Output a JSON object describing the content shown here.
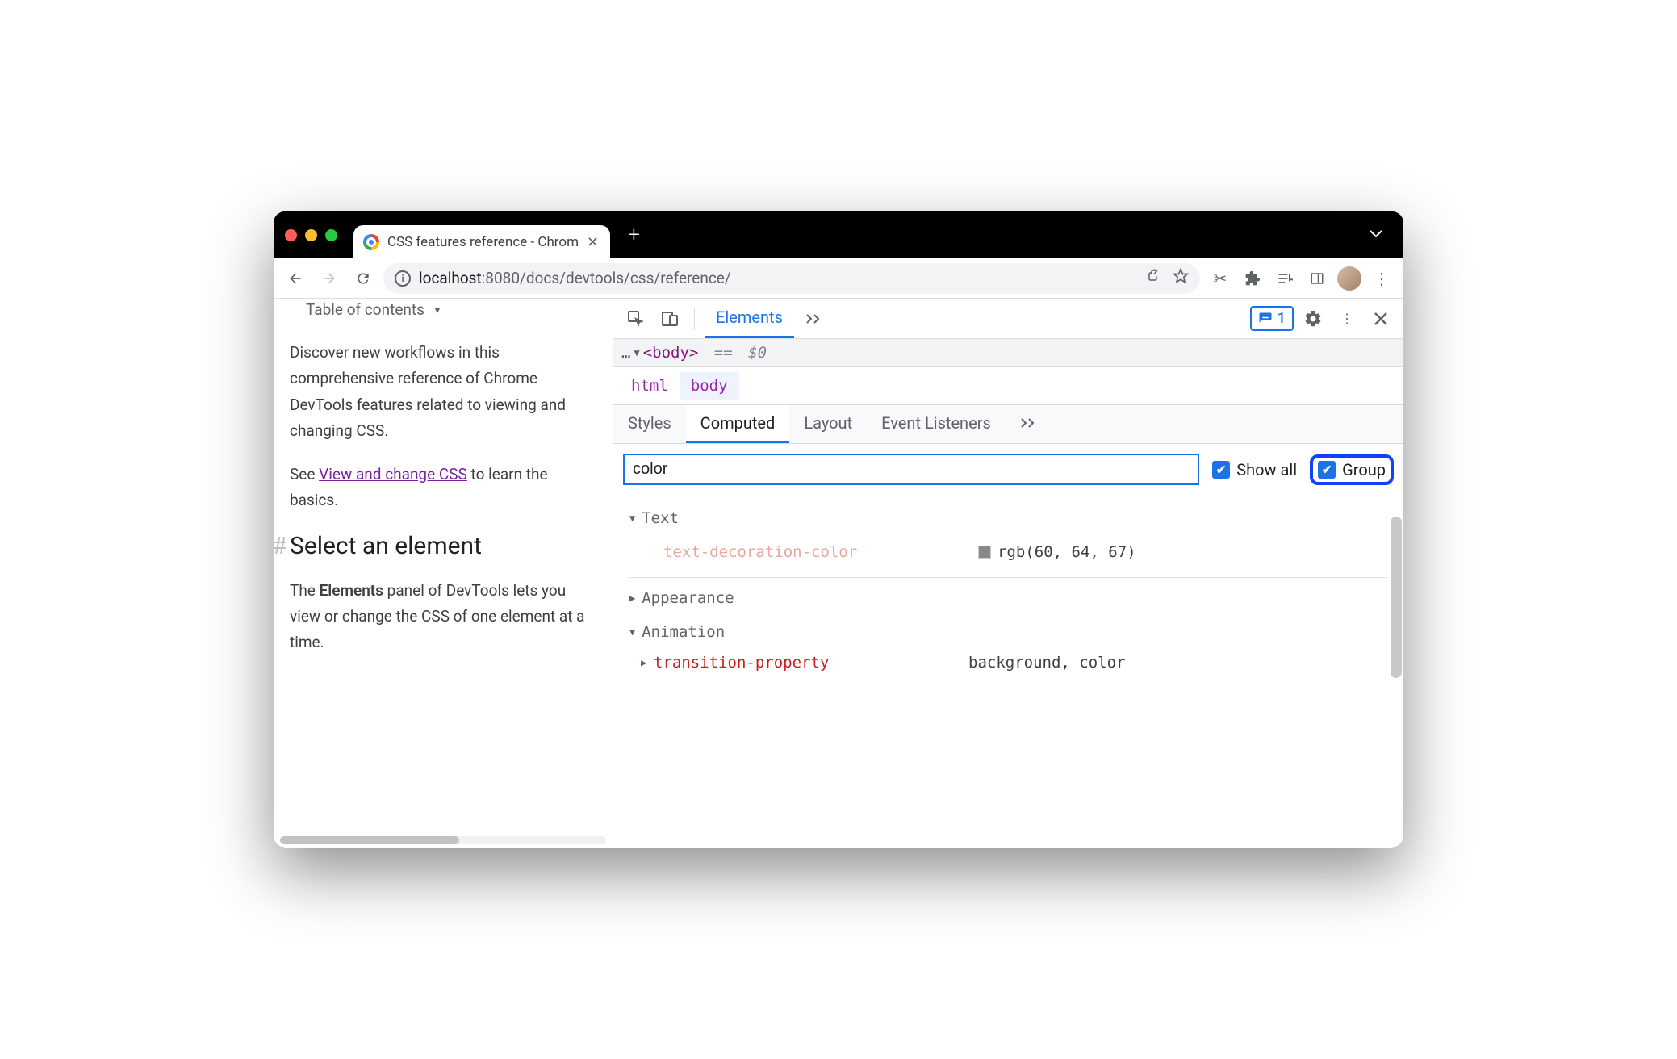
{
  "tab": {
    "title": "CSS features reference - Chrom"
  },
  "url": {
    "host": "localhost",
    "port": ":8080",
    "path": "/docs/devtools/css/reference/"
  },
  "page": {
    "toc_label": "Table of contents",
    "intro": "Discover new workflows in this comprehensive reference of Chrome DevTools features related to viewing and changing CSS.",
    "see_prefix": "See ",
    "see_link": "View and change CSS",
    "see_suffix": " to learn the basics.",
    "h2": "Select an element",
    "p2_prefix": "The ",
    "p2_strong": "Elements",
    "p2_suffix": " panel of DevTools lets you view or change the CSS of one element at a time."
  },
  "devtools": {
    "main_tab": "Elements",
    "issues_count": "1",
    "dom_tag": "<body>",
    "dom_eq": "==",
    "dom_dollar": "$0",
    "crumbs": {
      "html": "html",
      "body": "body"
    },
    "sub_tabs": {
      "styles": "Styles",
      "computed": "Computed",
      "layout": "Layout",
      "eventlisteners": "Event Listeners"
    },
    "filter_value": "color",
    "show_all_label": "Show all",
    "group_label": "Group",
    "groups": {
      "text": {
        "label": "Text",
        "prop_name": "text-decoration-color",
        "prop_value": "rgb(60, 64, 67)"
      },
      "appearance": {
        "label": "Appearance"
      },
      "animation": {
        "label": "Animation",
        "prop_name": "transition-property",
        "prop_value": "background, color"
      }
    }
  }
}
